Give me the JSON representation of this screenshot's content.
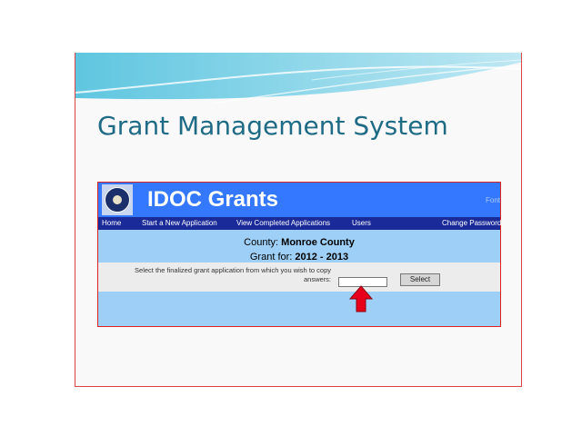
{
  "slide": {
    "title": "Grant Management System"
  },
  "screenshot": {
    "app_name": "IDOC Grants",
    "font_link": "Font",
    "nav": {
      "home": "Home",
      "start_new": "Start a New Application",
      "view_completed": "View Completed Applications",
      "users": "Users",
      "change_password": "Change Password"
    },
    "county_label": "County:",
    "county_value": "Monroe County",
    "grant_label": "Grant for:",
    "grant_value": "2012 - 2013",
    "instruction": "Select the finalized grant application from which you wish to copy answers:",
    "select_button": "Select"
  },
  "colors": {
    "title": "#1f6b86",
    "header_blue": "#3478ff",
    "nav_blue": "#1a2a99",
    "page_light_blue": "#9dcff7",
    "cursor_red": "#e8001a"
  },
  "icons": [
    "seal-icon",
    "cursor-arrow-icon"
  ]
}
